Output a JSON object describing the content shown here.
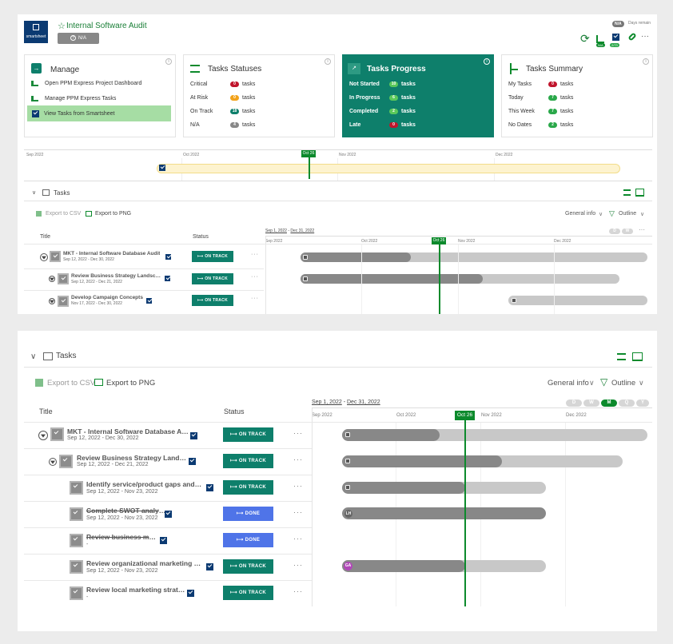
{
  "header": {
    "title": "Internal Software Audit",
    "logo_text": "smartsheet",
    "status_button": "N/A",
    "days_badge": "N/A",
    "days_label": "Days remain",
    "sync_badge": "N/A",
    "score_badge": "2/73"
  },
  "cards": {
    "manage": {
      "title": "Manage",
      "items": [
        "Open PPM Express Project Dashboard",
        "Manage PPM Express Tasks",
        "View Tasks from Smartsheet"
      ]
    },
    "statuses": {
      "title": "Tasks Statuses",
      "rows": [
        {
          "k": "Critical",
          "n": "0",
          "u": "tasks"
        },
        {
          "k": "At Risk",
          "n": "0",
          "u": "tasks"
        },
        {
          "k": "On Track",
          "n": "18",
          "u": "tasks"
        },
        {
          "k": "N/A",
          "n": "4",
          "u": "tasks"
        }
      ]
    },
    "progress": {
      "title": "Tasks Progress",
      "rows": [
        {
          "k": "Not Started",
          "n": "10",
          "u": "tasks"
        },
        {
          "k": "In Progress",
          "n": "6",
          "u": "tasks"
        },
        {
          "k": "Completed",
          "n": "2",
          "u": "tasks"
        },
        {
          "k": "Late",
          "n": "0",
          "u": "tasks"
        }
      ]
    },
    "summary": {
      "title": "Tasks Summary",
      "rows": [
        {
          "k": "My Tasks",
          "n": "0",
          "u": "tasks"
        },
        {
          "k": "Today",
          "n": "7",
          "u": "tasks"
        },
        {
          "k": "This Week",
          "n": "7",
          "u": "tasks"
        },
        {
          "k": "No Dates",
          "n": "2",
          "u": "tasks"
        }
      ]
    }
  },
  "colors": {
    "accent": "#0c8a2c",
    "teal": "#0e7f6b",
    "done": "#4f74e8",
    "red": "#c0152c",
    "orange": "#f2a21a",
    "green": "#2aa84a"
  },
  "timeline": {
    "months": [
      "Sep 2022",
      "Oct 2022",
      "Nov 2022",
      "Dec 2022"
    ],
    "today": "Oct 26"
  },
  "tasks_panel": {
    "title": "Tasks",
    "export_csv": "Export to CSV",
    "export_png": "Export to PNG",
    "general_info": "General info",
    "outline": "Outline",
    "col_title": "Title",
    "col_status": "Status",
    "range_start": "Sep 1, 2022",
    "range_sep": " - ",
    "range_end": "Dec 31, 2022",
    "zoom": [
      "D",
      "W",
      "M",
      "Q",
      "Y"
    ]
  },
  "tasks_top": [
    {
      "title": "MKT - Internal Software Database Audit",
      "dates": "Sep 12, 2022 - Dec 30, 2022",
      "status": "ON TRACK"
    },
    {
      "title": "Review Business Strategy Landscape",
      "dates": "Sep 12, 2022 - Dec 21, 2022",
      "status": "ON TRACK"
    },
    {
      "title": "Develop Campaign Concepts",
      "dates": "Nov 17, 2022 - Dec 30, 2022",
      "status": "ON TRACK"
    }
  ],
  "tasks": [
    {
      "title": "MKT - Internal Software Database Audit",
      "dates": "Sep 12, 2022 - Dec 30, 2022",
      "status": "ON TRACK"
    },
    {
      "title": "Review Business Strategy Landscape",
      "dates": "Sep 12, 2022 - Dec 21, 2022",
      "status": "ON TRACK"
    },
    {
      "title": "Identify service/product gaps and o...",
      "dates": "Sep 12, 2022 - Nov 23, 2022",
      "status": "ON TRACK"
    },
    {
      "title": "Complete SWOT analysis",
      "dates": "Sep 12, 2022 - Nov 23, 2022",
      "status": "DONE",
      "avatar": "LH"
    },
    {
      "title": "Review business model",
      "dates": "-",
      "status": "DONE"
    },
    {
      "title": "Review organizational marketing str...",
      "dates": "Sep 12, 2022 - Nov 23, 2022",
      "status": "ON TRACK",
      "avatar": "GA"
    },
    {
      "title": "Review local marketing strategy",
      "dates": "-",
      "status": "ON TRACK"
    }
  ],
  "glyphs": {
    "star": "☆",
    "gear": "?",
    "arrow": "→",
    "chev": "∨",
    "funnel": "▽",
    "more": "···",
    "refresh": "⟳",
    "link": "🔗",
    "launch": "⊕",
    "list": "☰",
    "gantt": "▦",
    "info": "i",
    "track": "⟼"
  }
}
